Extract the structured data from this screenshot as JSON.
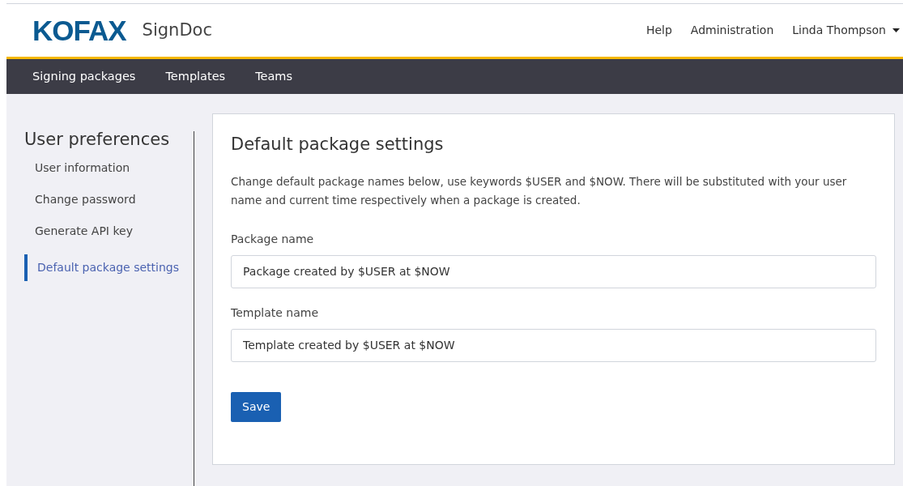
{
  "header": {
    "logo": "KOFAX",
    "product": "SignDoc",
    "links": [
      "Help",
      "Administration"
    ],
    "user_menu": "Linda Thompson"
  },
  "nav": {
    "items": [
      {
        "label": "Signing packages",
        "selected": false
      },
      {
        "label": "Templates",
        "selected": false
      },
      {
        "label": "Teams",
        "selected": false
      }
    ]
  },
  "sidebar": {
    "title": "User preferences",
    "items": [
      {
        "label": "User information",
        "selected": false
      },
      {
        "label": "Change password",
        "selected": false
      },
      {
        "label": "Generate API key",
        "selected": false
      },
      {
        "label": "Default package settings",
        "selected": true
      }
    ]
  },
  "card": {
    "title": "Default package settings",
    "description": "Change default package names below, use keywords $USER and $NOW. There will be substituted with your user name and current time respectively when a package is created.",
    "fields": [
      {
        "label": "Package name",
        "value": "Package created by $USER at $NOW"
      },
      {
        "label": "Template name",
        "value": "Template created by $USER at $NOW"
      }
    ],
    "button": "Save"
  }
}
